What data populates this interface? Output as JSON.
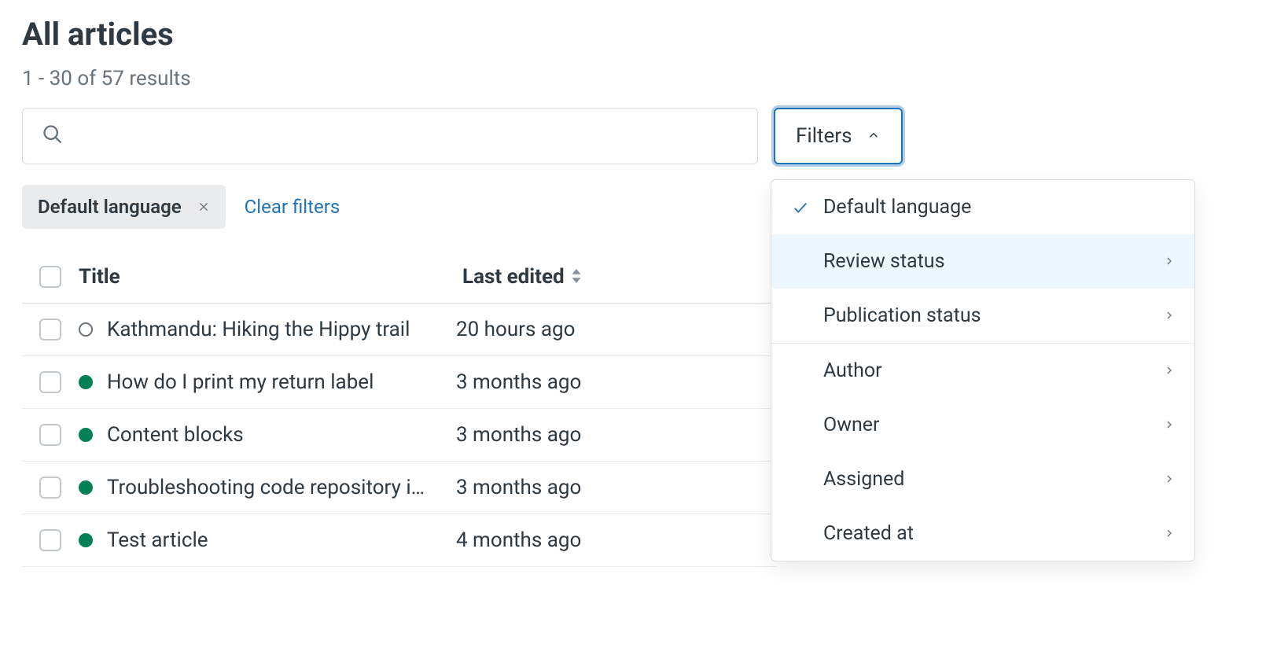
{
  "page": {
    "title": "All articles",
    "results_count": "1 - 30 of 57 results"
  },
  "search": {
    "placeholder": ""
  },
  "filters_toggle": {
    "label": "Filters"
  },
  "active_filter_chip": {
    "label": "Default language"
  },
  "clear_filters": "Clear filters",
  "columns": {
    "title": "Title",
    "last_edited": "Last edited"
  },
  "rows": [
    {
      "status": "hollow",
      "title": "Kathmandu: Hiking the Hippy trail",
      "last_edited": "20 hours ago"
    },
    {
      "status": "green",
      "title": "How do I print my return label",
      "last_edited": "3 months ago"
    },
    {
      "status": "green",
      "title": "Content blocks",
      "last_edited": "3 months ago"
    },
    {
      "status": "green",
      "title": "Troubleshooting code repository i…",
      "last_edited": "3 months ago"
    },
    {
      "status": "green",
      "title": "Test article",
      "last_edited": "4 months ago"
    }
  ],
  "filter_menu": {
    "checked": "Default language",
    "items": [
      {
        "label": "Review status",
        "hover": true
      },
      {
        "label": "Publication status",
        "hover": false
      }
    ],
    "more": [
      {
        "label": "Author"
      },
      {
        "label": "Owner"
      },
      {
        "label": "Assigned"
      },
      {
        "label": "Created at"
      }
    ]
  }
}
